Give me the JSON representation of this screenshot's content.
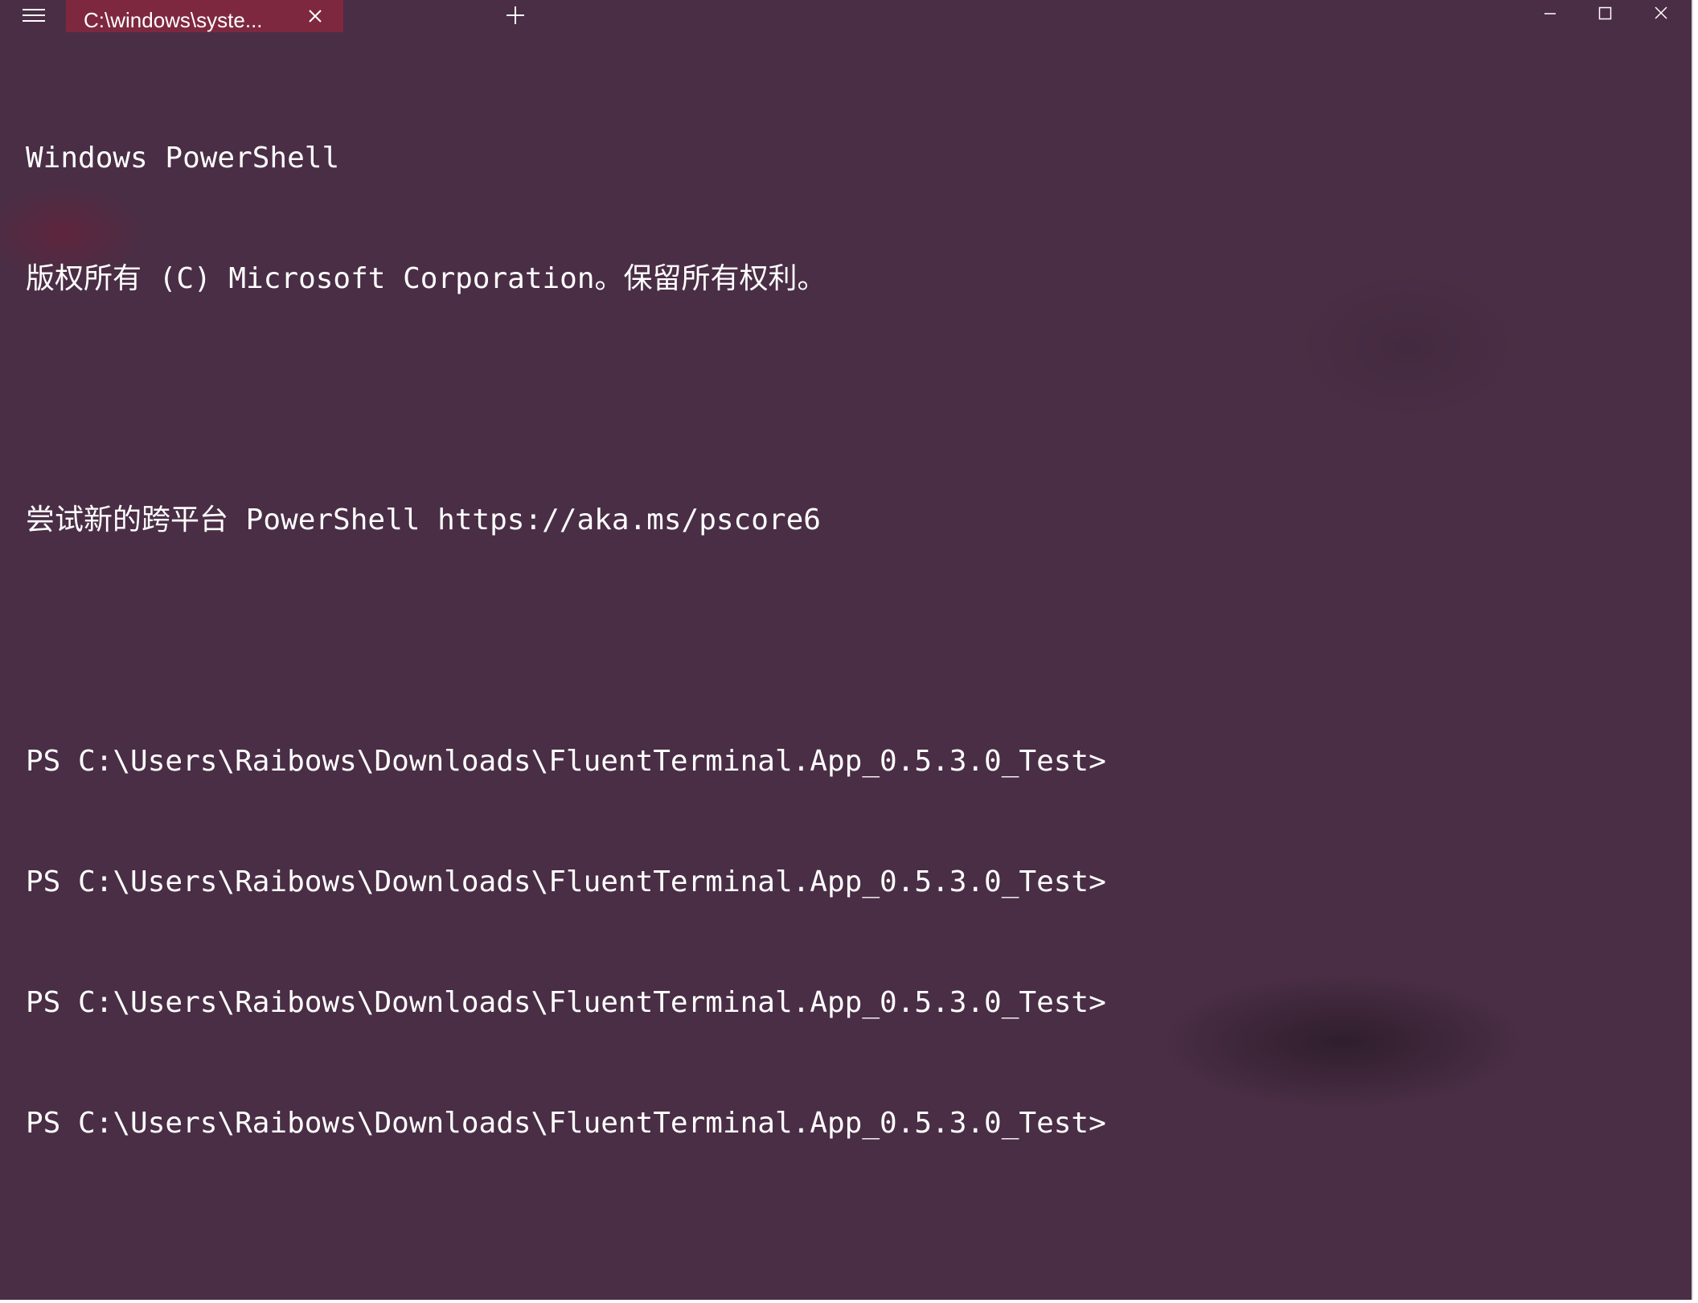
{
  "window": {
    "background": "#4a2e45",
    "accent": "#7e2840"
  },
  "titlebar": {
    "menu_icon": "hamburger-menu-icon",
    "tab": {
      "title": "C:\\windows\\syste...",
      "close_icon": "close-icon"
    },
    "new_tab_icon": "plus-icon",
    "controls": {
      "minimize_icon": "minimize-icon",
      "maximize_icon": "maximize-icon",
      "close_icon": "close-icon"
    }
  },
  "terminal": {
    "lines": [
      "Windows PowerShell",
      "版权所有 (C) Microsoft Corporation。保留所有权利。",
      "",
      "尝试新的跨平台 PowerShell https://aka.ms/pscore6",
      "",
      "PS C:\\Users\\Raibows\\Downloads\\FluentTerminal.App_0.5.3.0_Test>",
      "PS C:\\Users\\Raibows\\Downloads\\FluentTerminal.App_0.5.3.0_Test>",
      "PS C:\\Users\\Raibows\\Downloads\\FluentTerminal.App_0.5.3.0_Test>",
      "PS C:\\Users\\Raibows\\Downloads\\FluentTerminal.App_0.5.3.0_Test>"
    ]
  }
}
